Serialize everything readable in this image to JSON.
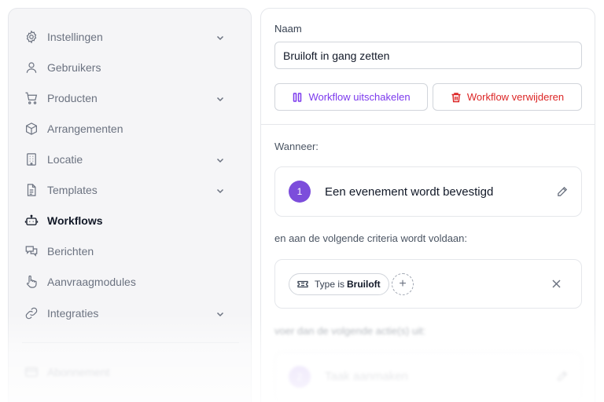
{
  "sidebar": {
    "items": [
      {
        "label": "Instellingen",
        "icon": "gear-icon",
        "has_chevron": true,
        "active": false
      },
      {
        "label": "Gebruikers",
        "icon": "user-icon",
        "has_chevron": false,
        "active": false
      },
      {
        "label": "Producten",
        "icon": "cart-icon",
        "has_chevron": true,
        "active": false
      },
      {
        "label": "Arrangementen",
        "icon": "box-icon",
        "has_chevron": false,
        "active": false
      },
      {
        "label": "Locatie",
        "icon": "building-icon",
        "has_chevron": true,
        "active": false
      },
      {
        "label": "Templates",
        "icon": "document-icon",
        "has_chevron": true,
        "active": false
      },
      {
        "label": "Workflows",
        "icon": "robot-icon",
        "has_chevron": false,
        "active": true
      },
      {
        "label": "Berichten",
        "icon": "chat-icon",
        "has_chevron": false,
        "active": false
      },
      {
        "label": "Aanvraagmodules",
        "icon": "pointer-hand-icon",
        "has_chevron": false,
        "active": false
      },
      {
        "label": "Integraties",
        "icon": "link-icon",
        "has_chevron": true,
        "active": false
      }
    ],
    "footer_items": [
      {
        "label": "Abonnement",
        "icon": "credit-card-icon"
      }
    ]
  },
  "form": {
    "name_label": "Naam",
    "name_value": "Bruiloft in gang zetten",
    "disable_button": "Workflow uitschakelen",
    "delete_button": "Workflow verwijderen"
  },
  "trigger": {
    "section_label": "Wanneer:",
    "step_number": "1",
    "title": "Een evenement wordt bevestigd"
  },
  "criteria": {
    "section_label": "en aan de volgende criteria wordt voldaan:",
    "chip_prefix": "Type is",
    "chip_value": "Bruiloft",
    "add_symbol": "+"
  },
  "actions": {
    "section_label": "voer dan de volgende actie(s) uit:",
    "step_number": "2",
    "title": "Taak aanmaken"
  },
  "colors": {
    "accent": "#7c4ddb",
    "danger": "#dc2626",
    "sidebar_bg": "#f5f5f7"
  }
}
